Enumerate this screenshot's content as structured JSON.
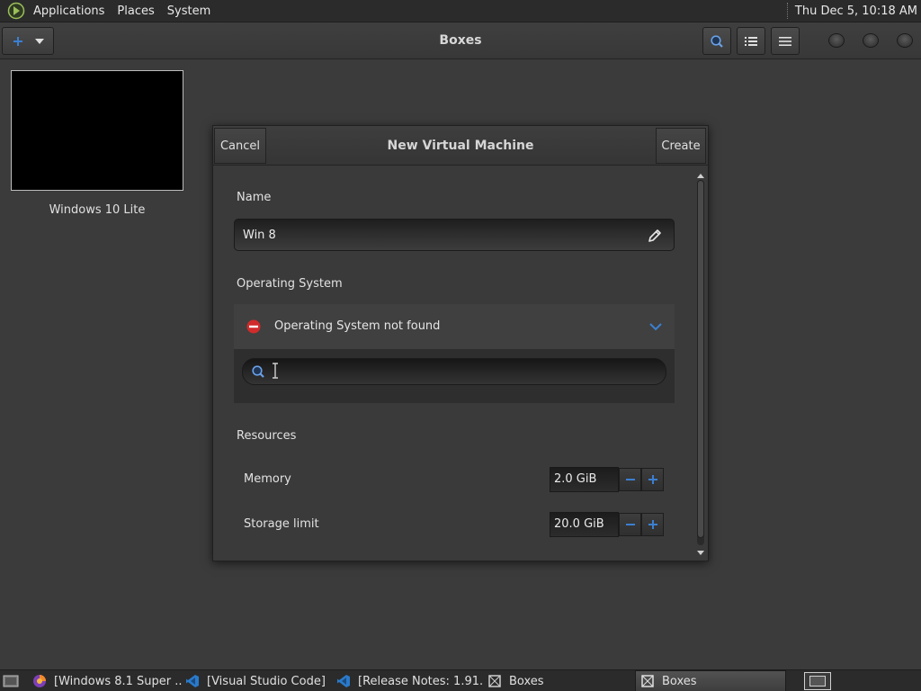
{
  "top_panel": {
    "menus": [
      "Applications",
      "Places",
      "System"
    ],
    "clock": "Thu Dec  5, 10:18 AM"
  },
  "headerbar": {
    "title": "Boxes",
    "new_icon": "plus-icon",
    "menu_icon": "chevron-down-icon",
    "search_icon": "search-icon",
    "list_icon": "list-view-icon",
    "hamburger_icon": "hamburger-menu-icon"
  },
  "collection": {
    "items": [
      {
        "label": "Windows 10 Lite"
      }
    ]
  },
  "dialog": {
    "cancel_label": "Cancel",
    "title": "New Virtual Machine",
    "create_label": "Create",
    "name_label": "Name",
    "name_value": "Win 8",
    "os_label": "Operating System",
    "os_status": "Operating System not found",
    "os_search_value": "",
    "resources_label": "Resources",
    "memory_label": "Memory",
    "memory_value": "2.0 GiB",
    "storage_label": "Storage limit",
    "storage_value": "20.0 GiB",
    "accent_color": "#3b7fd1",
    "error_color": "#d12b2b"
  },
  "taskbar": {
    "tasks": [
      {
        "label": "[Windows 8.1 Super ...",
        "icon": "firefox-icon",
        "active": false
      },
      {
        "label": "[Visual Studio Code]",
        "icon": "vscode-icon",
        "active": false
      },
      {
        "label": "[Release Notes: 1.91...",
        "icon": "vscode-icon",
        "active": false
      },
      {
        "label": "Boxes",
        "icon": "boxes-icon",
        "active": false
      },
      {
        "label": "Boxes",
        "icon": "boxes-icon",
        "active": true
      }
    ]
  }
}
